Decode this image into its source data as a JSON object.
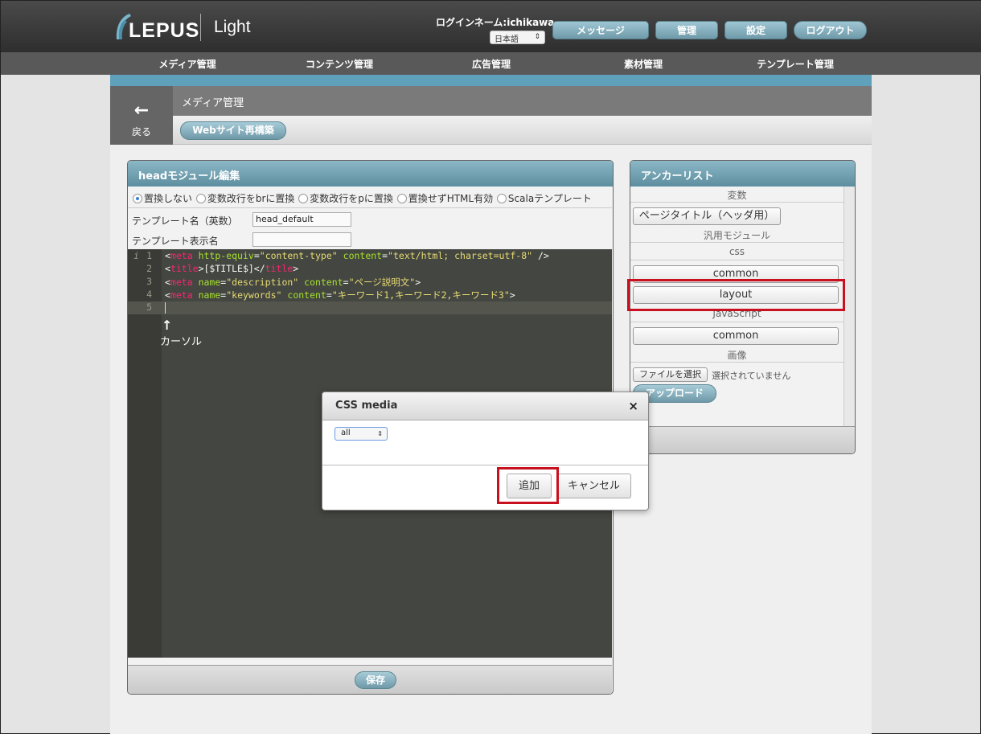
{
  "header": {
    "logo_text": "LEPUS",
    "product": "Light",
    "login_label": "ログインネーム:ichikawa",
    "language": "日本語",
    "buttons": {
      "messages": "メッセージ",
      "admin": "管理",
      "settings": "設定",
      "logout": "ログアウト"
    },
    "accent_color": "#5fa0bb"
  },
  "nav": {
    "items": [
      "メディア管理",
      "コンテンツ管理",
      "広告管理",
      "素材管理",
      "テンプレート管理"
    ]
  },
  "subheader": {
    "back_label": "戻る",
    "breadcrumb": "メディア管理",
    "rebuild_button": "Webサイト再構築"
  },
  "editor_panel": {
    "title": "headモジュール編集",
    "radio_options": [
      "置換しない",
      "変数改行をbrに置換",
      "変数改行をpに置換",
      "置換せずHTML有効",
      "Scalaテンプレート"
    ],
    "selected_radio": "置換しない",
    "template_name_label": "テンプレート名（英数）",
    "template_name_value": "head_default",
    "display_name_label": "テンプレート表示名",
    "display_name_value": "",
    "code_lines": [
      {
        "num": "1",
        "text": "<meta http-equiv=\"content-type\" content=\"text/html; charset=utf-8\" />"
      },
      {
        "num": "2",
        "text": "<title>[$TITLE$]</title>"
      },
      {
        "num": "3",
        "text": "<meta name=\"description\" content=\"ページ説明文\">"
      },
      {
        "num": "4",
        "text": "<meta name=\"keywords\" content=\"キーワード1,キーワード2,キーワード3\">"
      },
      {
        "num": "5",
        "text": ""
      }
    ],
    "info_marker": "i",
    "cursor_annotation": "カーソル",
    "save_button": "保存"
  },
  "anchor_panel": {
    "title": "アンカーリスト",
    "variables_header": "変数",
    "page_title_button": "ページタイトル（ヘッダ用）",
    "modules_header": "汎用モジュール",
    "css_header": "css",
    "css_items": [
      "common",
      "layout"
    ],
    "js_header": "JavaScript",
    "js_items": [
      "common"
    ],
    "images_header": "画像",
    "file_button": "ファイルを選択",
    "no_file_text": "選択されていません",
    "upload_button": "アップロード"
  },
  "modal": {
    "title": "CSS media",
    "close_symbol": "×",
    "media_value": "all",
    "add_button": "追加",
    "cancel_button": "キャンセル"
  }
}
